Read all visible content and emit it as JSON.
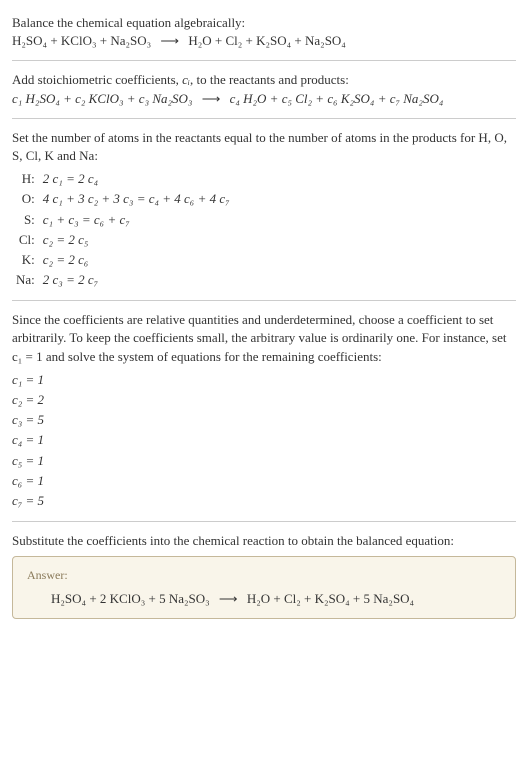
{
  "intro": {
    "line1": "Balance the chemical equation algebraically:",
    "eq_lhs": "H₂SO₄ + KClO₃ + Na₂SO₃",
    "arrow": "⟶",
    "eq_rhs": "H₂O + Cl₂ + K₂SO₄ + Na₂SO₄"
  },
  "stoich": {
    "text": "Add stoichiometric coefficients, ",
    "ci": "cᵢ",
    "text2": ", to the reactants and products:",
    "eq_lhs_c": "c₁ H₂SO₄ + c₂ KClO₃ + c₃ Na₂SO₃",
    "arrow": "⟶",
    "eq_rhs_c": "c₄ H₂O + c₅ Cl₂ + c₆ K₂SO₄ + c₇ Na₂SO₄"
  },
  "atoms": {
    "text": "Set the number of atoms in the reactants equal to the number of atoms in the products for H, O, S, Cl, K and Na:",
    "rows": [
      {
        "el": "H:",
        "eq": "2 c₁ = 2 c₄"
      },
      {
        "el": "O:",
        "eq": "4 c₁ + 3 c₂ + 3 c₃ = c₄ + 4 c₆ + 4 c₇"
      },
      {
        "el": "S:",
        "eq": "c₁ + c₃ = c₆ + c₇"
      },
      {
        "el": "Cl:",
        "eq": "c₂ = 2 c₅"
      },
      {
        "el": "K:",
        "eq": "c₂ = 2 c₆"
      },
      {
        "el": "Na:",
        "eq": "2 c₃ = 2 c₇"
      }
    ]
  },
  "solve": {
    "text": "Since the coefficients are relative quantities and underdetermined, choose a coefficient to set arbitrarily. To keep the coefficients small, the arbitrary value is ordinarily one. For instance, set c₁ = 1 and solve the system of equations for the remaining coefficients:",
    "coeffs": [
      "c₁ = 1",
      "c₂ = 2",
      "c₃ = 5",
      "c₄ = 1",
      "c₅ = 1",
      "c₆ = 1",
      "c₇ = 5"
    ]
  },
  "sub": {
    "text": "Substitute the coefficients into the chemical reaction to obtain the balanced equation:"
  },
  "answer": {
    "label": "Answer:",
    "eq_lhs": "H₂SO₄ + 2 KClO₃ + 5 Na₂SO₃",
    "arrow": "⟶",
    "eq_rhs": "H₂O + Cl₂ + K₂SO₄ + 5 Na₂SO₄"
  }
}
